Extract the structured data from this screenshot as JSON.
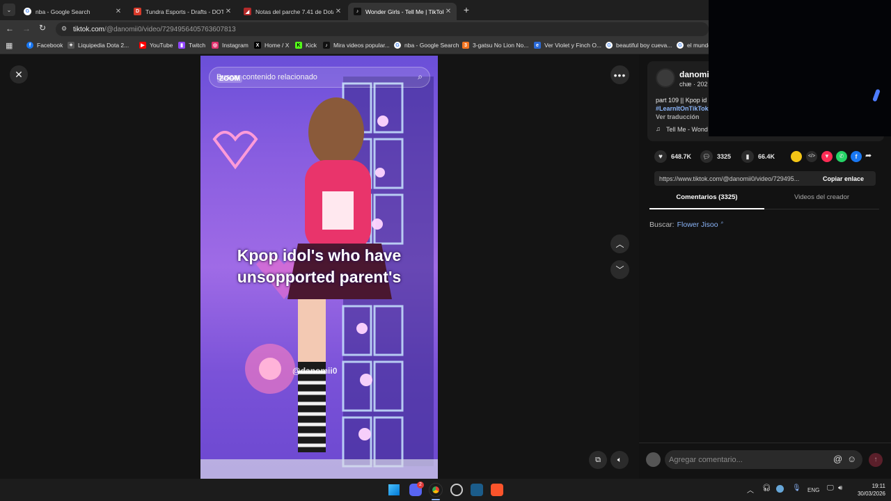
{
  "browser": {
    "tabs": [
      {
        "title": "nba - Google Search",
        "icon": "google-icon",
        "color": "#ffffff"
      },
      {
        "title": "Tundra Esports - Drafts - DOTA",
        "icon": "dota-icon",
        "color": "#d83a2a"
      },
      {
        "title": "Notas del parche 7.41 de Dota",
        "icon": "dota-patch-icon",
        "color": "#b32a2a"
      },
      {
        "title": "Wonder Girls - Tell Me | TikTok",
        "icon": "tiktok-icon",
        "color": "#111111"
      }
    ],
    "url_domain": "tiktok.com",
    "url_path": "/@danomii0/video/7294956405763607813",
    "bookmarks": [
      {
        "label": "Facebook",
        "icon": "facebook-icon",
        "color": "#1877f2"
      },
      {
        "label": "Liquipedia Dota 2...",
        "icon": "liquipedia-icon",
        "color": "#555555"
      },
      {
        "label": "YouTube",
        "icon": "youtube-icon",
        "color": "#ff0000"
      },
      {
        "label": "Twitch",
        "icon": "twitch-icon",
        "color": "#9146ff"
      },
      {
        "label": "Instagram",
        "icon": "instagram-icon",
        "color": "#e1306c"
      },
      {
        "label": "Home / X",
        "icon": "x-icon",
        "color": "#000000"
      },
      {
        "label": "Kick",
        "icon": "kick-icon",
        "color": "#53fc18"
      },
      {
        "label": "Mira videos popular...",
        "icon": "tiktok-icon",
        "color": "#111111"
      },
      {
        "label": "nba - Google Search",
        "icon": "google-icon",
        "color": "#ffffff"
      },
      {
        "label": "3-gatsu No Lion No...",
        "icon": "crunchy-icon",
        "color": "#f47521"
      },
      {
        "label": "Ver Violet y Finch O...",
        "icon": "e-icon",
        "color": "#2a6ad8"
      },
      {
        "label": "beautiful boy cueva...",
        "icon": "google-icon",
        "color": "#ffffff"
      },
      {
        "label": "el mundo",
        "icon": "google-icon",
        "color": "#ffffff"
      }
    ]
  },
  "video": {
    "search_placeholder": "Buscar contenido relacionado",
    "caption_line1": "Kpop idol's who have",
    "caption_line2": "unsopported parent's",
    "watermark": "@danomii0",
    "zoom_logo": "ZOOM"
  },
  "author": {
    "name": "danomii",
    "sub": "chæ · 202"
  },
  "description": {
    "text": "part 109 || Kpop id",
    "hashtag": "#LearnItOnTikTok",
    "translate": "Ver traducción",
    "music": "Tell Me - Wond"
  },
  "stats": {
    "likes": "648.7K",
    "comments": "3325",
    "saves": "66.4K"
  },
  "share": {
    "link": "https://www.tiktok.com/@danomii0/video/729495...",
    "copy_label": "Copiar enlace"
  },
  "tabs": {
    "comments": "Comentarios (3325)",
    "creator": "Videos del creador"
  },
  "search_suggest": {
    "prefix": "Buscar:",
    "term": "Flower Jisoo"
  },
  "comment_input": {
    "placeholder": "Agregar comentario..."
  },
  "system": {
    "lang": "ENG",
    "time": "19:11",
    "date": "30/03/2026",
    "discord_badge": "2"
  }
}
